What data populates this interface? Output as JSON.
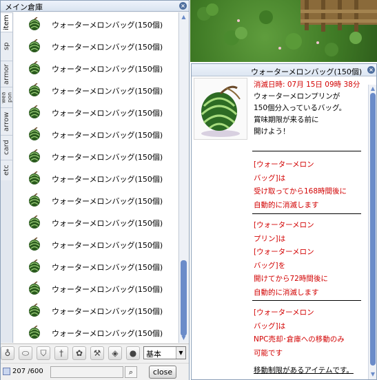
{
  "storage": {
    "title": "メイン倉庫",
    "tabs": [
      {
        "label": "item",
        "active": true
      },
      {
        "label": "sp",
        "active": false
      },
      {
        "label": "armor",
        "active": false
      },
      {
        "label": "wea pon",
        "active": false
      },
      {
        "label": "arrow",
        "active": false
      },
      {
        "label": "card",
        "active": false
      },
      {
        "label": "etc",
        "active": false
      }
    ],
    "items": [
      {
        "name": "ウォーターメロンバッグ(150個)",
        "icon": "watermelon-bag-icon"
      },
      {
        "name": "ウォーターメロンバッグ(150個)",
        "icon": "watermelon-bag-icon"
      },
      {
        "name": "ウォーターメロンバッグ(150個)",
        "icon": "watermelon-bag-icon"
      },
      {
        "name": "ウォーターメロンバッグ(150個)",
        "icon": "watermelon-bag-icon"
      },
      {
        "name": "ウォーターメロンバッグ(150個)",
        "icon": "watermelon-bag-icon"
      },
      {
        "name": "ウォーターメロンバッグ(150個)",
        "icon": "watermelon-bag-icon"
      },
      {
        "name": "ウォーターメロンバッグ(150個)",
        "icon": "watermelon-bag-icon"
      },
      {
        "name": "ウォーターメロンバッグ(150個)",
        "icon": "watermelon-bag-icon"
      },
      {
        "name": "ウォーターメロンバッグ(150個)",
        "icon": "watermelon-bag-icon"
      },
      {
        "name": "ウォーターメロンバッグ(150個)",
        "icon": "watermelon-bag-icon"
      },
      {
        "name": "ウォーターメロンバッグ(150個)",
        "icon": "watermelon-bag-icon"
      },
      {
        "name": "ウォーターメロンバッグ(150個)",
        "icon": "watermelon-bag-icon"
      },
      {
        "name": "ウォーターメロンバッグ(150個)",
        "icon": "watermelon-bag-icon"
      },
      {
        "name": "ウォーターメロンバッグ(150個)",
        "icon": "watermelon-bag-icon"
      },
      {
        "name": "ウォーターメロンバッグ(150個)",
        "icon": "watermelon-bag-icon"
      }
    ],
    "filter_icons": [
      "potion-icon",
      "disc-icon",
      "armor-icon",
      "sword-icon",
      "gear-icon",
      "tools-icon",
      "diamond-icon",
      "orb-icon"
    ],
    "filter_select": "基本",
    "count": "207 /600",
    "search_placeholder": "",
    "close_label": "close"
  },
  "info": {
    "title": "ウォーターメロンバッグ(150個)",
    "expire": "消滅日時: 07月 15日 09時 38分",
    "desc": [
      "ウォーターメロンプリンが",
      "150個分入っているバッグ。",
      "賞味期限が来る前に",
      "開けよう！"
    ],
    "block1": [
      "[ウォーターメロン",
      "バッグ]は",
      "受け取ってから168時間後に",
      "自動的に消滅します"
    ],
    "block2": [
      "[ウォーターメロン",
      "プリン]は",
      "[ウォーターメロン",
      "バッグ]を",
      "開けてから72時間後に",
      "自動的に消滅します"
    ],
    "block3": [
      "[ウォーターメロン",
      "バッグ]は",
      "NPC売却･倉庫への移動のみ",
      "可能です"
    ],
    "footer": "移動制限があるアイテムです。"
  },
  "colors": {
    "accent": "#6b8cc9",
    "warning_text": "#d20000"
  }
}
